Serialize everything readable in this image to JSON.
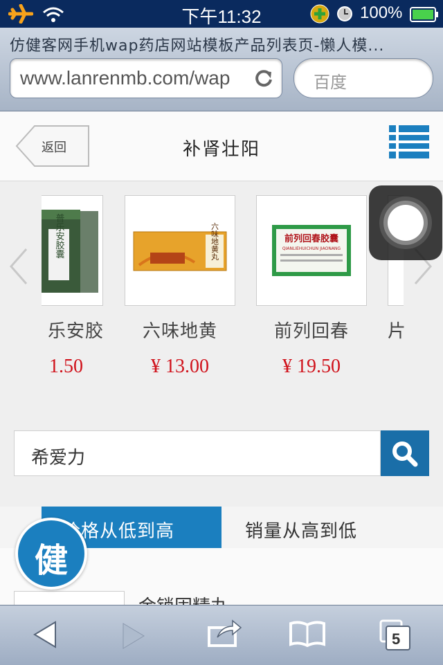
{
  "status_bar": {
    "time": "下午11:32",
    "battery_percent": "100%"
  },
  "browser": {
    "page_title": "仿健客网手机wap药店网站模板产品列表页-懒人模...",
    "url": "www.lanrenmb.com/wap",
    "search_placeholder": "百度"
  },
  "header": {
    "back_label": "返回",
    "title": "补肾壮阳"
  },
  "carousel": {
    "items": [
      {
        "name": "乐安胶",
        "price": "1.50"
      },
      {
        "name": "六味地黄",
        "price": "¥ 13.00"
      },
      {
        "name": "前列回春",
        "price": "¥ 19.50"
      },
      {
        "name": "片"
      }
    ],
    "product_labels": {
      "box2": "六味地黄丸",
      "box3": "前列回春胶囊",
      "box3_sub": "QIANLIEHUICHUN JIAONANG",
      "box1": "普乐安胶囊"
    }
  },
  "search": {
    "value": "希爱力"
  },
  "sort_tabs": [
    {
      "label": "价格从低到高",
      "active": true
    },
    {
      "label": "销量从高到低",
      "active": false
    }
  ],
  "list": {
    "first_item_name": "金锁固精丸"
  },
  "logo": {
    "char": "健"
  },
  "toolbar": {
    "tabs_count": "5"
  },
  "colors": {
    "brand_blue": "#1b7fbf",
    "price_red": "#d0121b",
    "status_bar": "#0a2a5e"
  }
}
